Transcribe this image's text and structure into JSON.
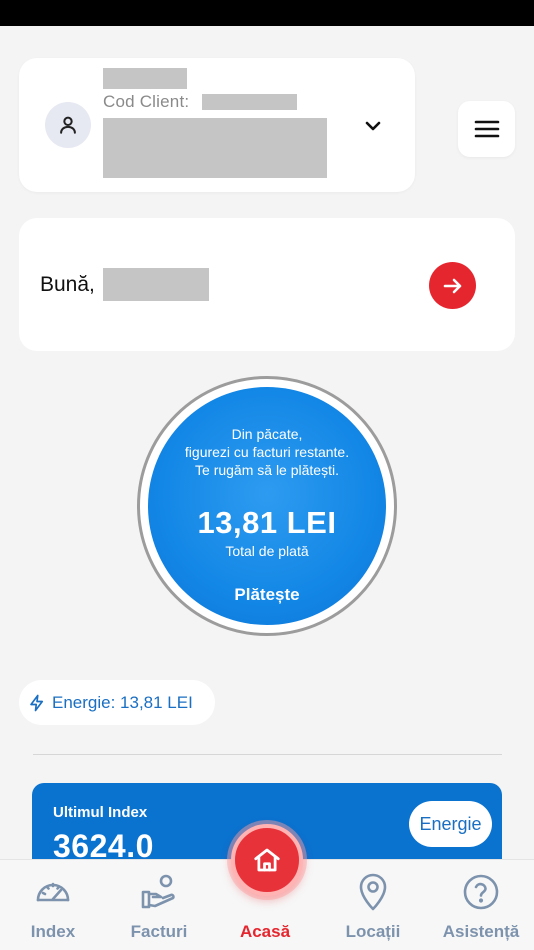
{
  "account": {
    "code_label": "Cod Client:"
  },
  "greeting": {
    "text": "Bună,"
  },
  "balance": {
    "message_lines": [
      "Din păcate,",
      "figurezi cu facturi restante.",
      "Te rugăm să le plătești."
    ],
    "amount": "13,81 LEI",
    "total_label": "Total de plată",
    "pay_label": "Plătește"
  },
  "energy_chip": {
    "label": "Energie: 13,81 LEI"
  },
  "index_card": {
    "title": "Ultimul Index",
    "value": "3624.0",
    "type_label": "Energie"
  },
  "tabs": [
    {
      "label": "Index",
      "icon": "gauge-icon"
    },
    {
      "label": "Facturi",
      "icon": "hand-bill-icon"
    },
    {
      "label": "Acasă",
      "icon": "home-icon"
    },
    {
      "label": "Locații",
      "icon": "location-pin-icon"
    },
    {
      "label": "Asistență",
      "icon": "help-circle-icon"
    }
  ],
  "colors": {
    "accent_red": "#e5262f",
    "primary_blue": "#1387e6",
    "tab_inactive": "#7d93ad"
  }
}
